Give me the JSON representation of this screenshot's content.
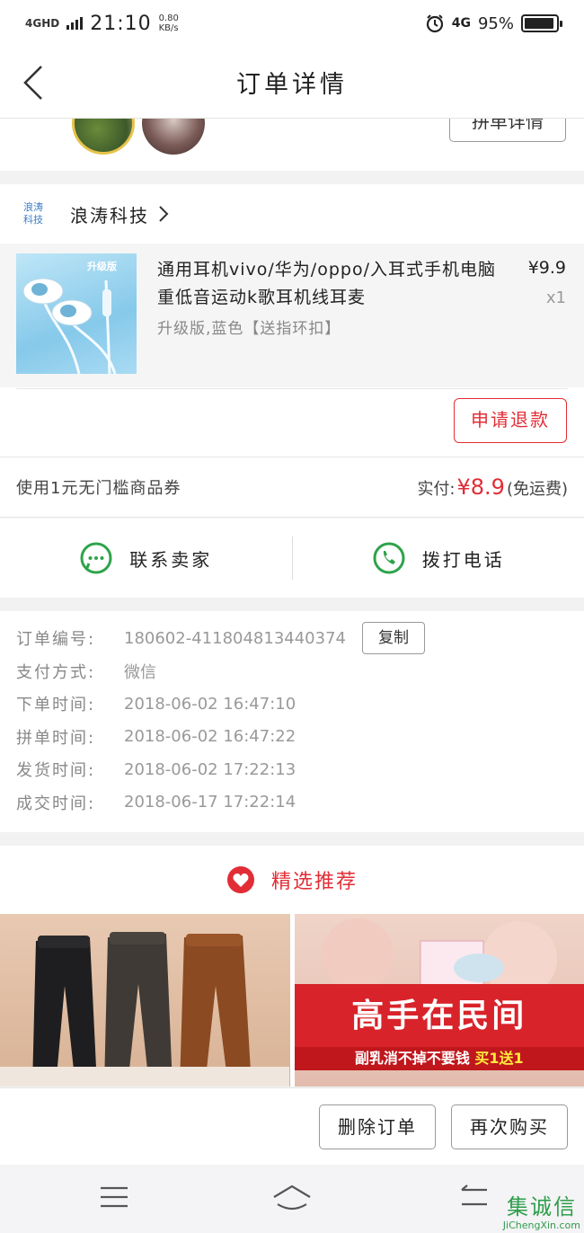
{
  "status_bar": {
    "network": "4GHD",
    "time": "21:10",
    "speed_value": "0.80",
    "speed_unit": "KB/s",
    "network_right": "4G",
    "battery": "95%",
    "battery_level": 0.95
  },
  "header": {
    "title": "订单详情"
  },
  "group": {
    "detail_button": "拼单详情"
  },
  "store": {
    "logo_text": "浪涛科技",
    "name": "浪涛科技"
  },
  "product": {
    "image_tag": "升级版",
    "title": "通用耳机vivo/华为/oppo/入耳式手机电脑重低音运动k歌耳机线耳麦",
    "price": "¥9.9",
    "quantity": "x1",
    "spec": "升级版,蓝色【送指环扣】",
    "refund_button": "申请退款"
  },
  "payment": {
    "coupon": "使用1元无门槛商品券",
    "paid_label": "实付:",
    "paid_amount": "¥8.9",
    "shipping_note": "(免运费)"
  },
  "contact": {
    "seller_label": "联系卖家",
    "phone_label": "拨打电话"
  },
  "order_info": {
    "copy_button": "复制",
    "rows": [
      {
        "label": "订单编号:",
        "value": "180602-411804813440374"
      },
      {
        "label": "支付方式:",
        "value": "微信"
      },
      {
        "label": "下单时间:",
        "value": "2018-06-02 16:47:10"
      },
      {
        "label": "拼单时间:",
        "value": "2018-06-02 16:47:22"
      },
      {
        "label": "发货时间:",
        "value": "2018-06-02 17:22:13"
      },
      {
        "label": "成交时间:",
        "value": "2018-06-17 17:22:14"
      }
    ]
  },
  "recommend": {
    "title": "精选推荐",
    "promo_main": "高手在民间",
    "promo_sub_left": "副乳消不掉不要钱",
    "promo_sub_right": "买1送1"
  },
  "actions": {
    "delete_button": "删除订单",
    "rebuy_button": "再次购买"
  },
  "watermark": {
    "chars": "集诚信",
    "url": "JiChengXin.com"
  },
  "colors": {
    "accent": "#e22d36",
    "wechat_green": "#2ea34a"
  }
}
